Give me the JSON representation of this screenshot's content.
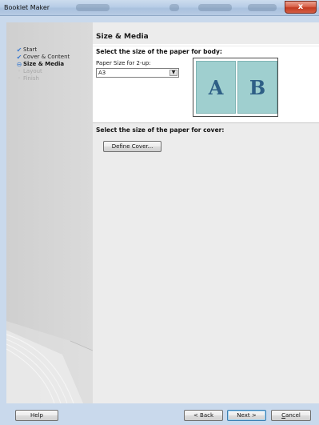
{
  "window": {
    "title": "Booklet Maker",
    "close_glyph": "x"
  },
  "sidebar": {
    "steps": [
      {
        "label": "Start",
        "state": "done",
        "icon": "check-icon",
        "glyph": "✔"
      },
      {
        "label": "Cover & Content",
        "state": "done",
        "icon": "check-icon",
        "glyph": "✔"
      },
      {
        "label": "Size & Media",
        "state": "current",
        "icon": "current-step-icon",
        "glyph": "⊖"
      },
      {
        "label": "Layout",
        "state": "future",
        "icon": "pending-step-icon",
        "glyph": "◦"
      },
      {
        "label": "Finish",
        "state": "future",
        "icon": "pending-step-icon",
        "glyph": "◦"
      }
    ]
  },
  "content": {
    "title": "Size & Media",
    "body_section": {
      "heading": "Select the size of the paper for body:",
      "paper_label": "Paper Size for 2-up:",
      "paper_value": "A3",
      "dropdown_glyph": "▼",
      "preview_pages": [
        "A",
        "B"
      ]
    },
    "cover_section": {
      "heading": "Select the size of the paper for cover:",
      "define_button": "Define Cover..."
    }
  },
  "footer": {
    "help": "Help",
    "back": "< Back",
    "next": "Next >",
    "cancel_accel": "C",
    "cancel_rest": "ancel"
  },
  "colors": {
    "frame": "#c9d9ec",
    "accent_check": "#3b7bd0",
    "preview_page": "#9fcfcf",
    "preview_letter": "#2e5f86",
    "close_red": "#c23b22"
  }
}
